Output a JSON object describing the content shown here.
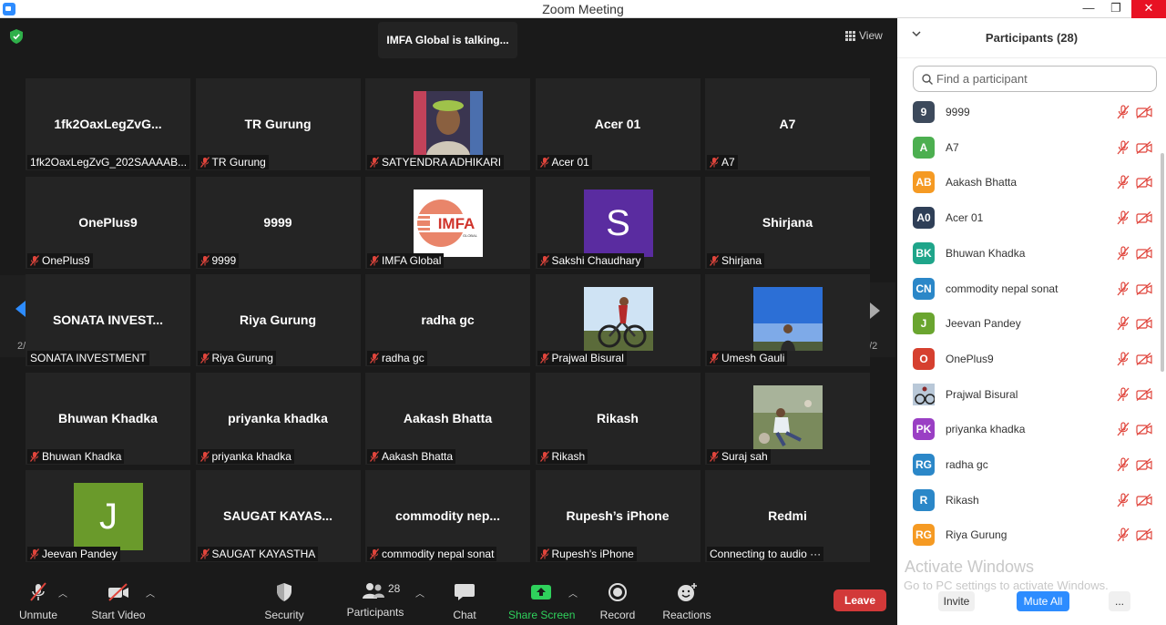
{
  "window": {
    "title": "Zoom Meeting",
    "minimize": "—",
    "restore": "❐",
    "close": "✕"
  },
  "meeting": {
    "talking": "IMFA Global is talking...",
    "view_label": "View",
    "page_left": "2/2",
    "page_right": "2/2"
  },
  "tiles": [
    {
      "big": "1fk2OaxLegZvG...",
      "label": "1fk2OaxLegZvG_202SAAAAB...",
      "muted": false
    },
    {
      "big": "TR Gurung",
      "label": "TR Gurung",
      "muted": true
    },
    {
      "big": "",
      "label": "SATYENDRA ADHIKARI",
      "muted": true,
      "media": "photo-satyendra"
    },
    {
      "big": "Acer 01",
      "label": "Acer 01",
      "muted": true
    },
    {
      "big": "A7",
      "label": "A7",
      "muted": true
    },
    {
      "big": "OnePlus9",
      "label": "OnePlus9",
      "muted": true
    },
    {
      "big": "9999",
      "label": "9999",
      "muted": true
    },
    {
      "big": "",
      "label": "IMFA Global",
      "muted": true,
      "media": "imfa-logo"
    },
    {
      "big": "",
      "label": "Sakshi Chaudhary",
      "muted": true,
      "media": "avatar-s"
    },
    {
      "big": "Shirjana",
      "label": "Shirjana",
      "muted": true
    },
    {
      "big": "SONATA  INVEST...",
      "label": "SONATA INVESTMENT",
      "muted": false
    },
    {
      "big": "Riya Gurung",
      "label": "Riya Gurung",
      "muted": true
    },
    {
      "big": "radha gc",
      "label": "radha gc",
      "muted": true
    },
    {
      "big": "",
      "label": "Prajwal Bisural",
      "muted": true,
      "media": "photo-prajwal"
    },
    {
      "big": "",
      "label": "Umesh Gauli",
      "muted": true,
      "media": "photo-umesh"
    },
    {
      "big": "Bhuwan Khadka",
      "label": "Bhuwan Khadka",
      "muted": true
    },
    {
      "big": "priyanka khadka",
      "label": "priyanka khadka",
      "muted": true
    },
    {
      "big": "Aakash Bhatta",
      "label": "Aakash Bhatta",
      "muted": true
    },
    {
      "big": "Rikash",
      "label": "Rikash",
      "muted": true
    },
    {
      "big": "",
      "label": "Suraj sah",
      "muted": true,
      "media": "photo-suraj"
    },
    {
      "big": "",
      "label": "Jeevan Pandey",
      "muted": true,
      "media": "avatar-j"
    },
    {
      "big": "SAUGAT KAYAS...",
      "label": "SAUGAT KAYASTHA",
      "muted": true
    },
    {
      "big": "commodity  nep...",
      "label": "commodity nepal sonat",
      "muted": true
    },
    {
      "big": "Rupesh’s iPhone",
      "label": "Rupesh's iPhone",
      "muted": true
    },
    {
      "big": "Redmi",
      "label": "Connecting to audio ···",
      "muted": false
    }
  ],
  "tile_avatars": {
    "s": "S",
    "j": "J",
    "imfa": "IMFA",
    "imfa_sub": "GLOBAL"
  },
  "toolbar": {
    "unmute": "Unmute",
    "start_video": "Start Video",
    "security": "Security",
    "participants": "Participants",
    "participants_count": "28",
    "chat": "Chat",
    "share_screen": "Share Screen",
    "record": "Record",
    "reactions": "Reactions",
    "leave": "Leave"
  },
  "panel": {
    "title": "Participants (28)",
    "search_placeholder": "Find a participant",
    "participants": [
      {
        "initials": "9",
        "name": "9999",
        "color": "#3d4a5c"
      },
      {
        "initials": "A",
        "name": "A7",
        "color": "#4caf50"
      },
      {
        "initials": "AB",
        "name": "Aakash Bhatta",
        "color": "#f59a23"
      },
      {
        "initials": "A0",
        "name": "Acer 01",
        "color": "#2f3f57"
      },
      {
        "initials": "BK",
        "name": "Bhuwan Khadka",
        "color": "#1fa58a"
      },
      {
        "initials": "CN",
        "name": "commodity nepal sonat",
        "color": "#2b87c8"
      },
      {
        "initials": "J",
        "name": "Jeevan Pandey",
        "color": "#6aa52f"
      },
      {
        "initials": "O",
        "name": "OnePlus9",
        "color": "#d6402f"
      },
      {
        "initials": "",
        "name": "Prajwal Bisural",
        "color": "#5b6b78"
      },
      {
        "initials": "PK",
        "name": "priyanka khadka",
        "color": "#9a3fc4"
      },
      {
        "initials": "RG",
        "name": "radha gc",
        "color": "#2b87c8"
      },
      {
        "initials": "R",
        "name": "Rikash",
        "color": "#2b87c8"
      },
      {
        "initials": "RG",
        "name": "Riya Gurung",
        "color": "#f59a23"
      }
    ],
    "activate_title": "Activate Windows",
    "activate_sub": "Go to PC settings to activate Windows.",
    "invite": "Invite",
    "mute_all": "Mute All",
    "more": "..."
  }
}
